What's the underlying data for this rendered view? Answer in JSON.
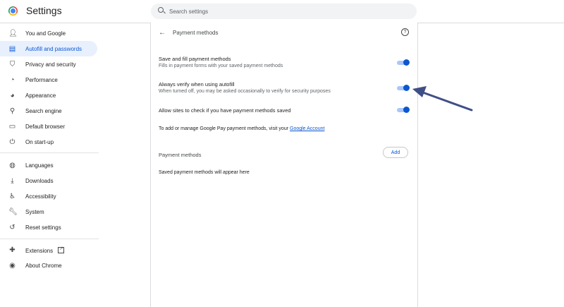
{
  "header": {
    "title": "Settings",
    "search_placeholder": "Search settings"
  },
  "sidebar": {
    "items": [
      {
        "label": "You and Google",
        "icon": "person-icon"
      },
      {
        "label": "Autofill and passwords",
        "icon": "clipboard-icon",
        "active": true
      },
      {
        "label": "Privacy and security",
        "icon": "shield-icon"
      },
      {
        "label": "Performance",
        "icon": "speedometer-icon"
      },
      {
        "label": "Appearance",
        "icon": "palette-icon"
      },
      {
        "label": "Search engine",
        "icon": "search-icon"
      },
      {
        "label": "Default browser",
        "icon": "browser-icon"
      },
      {
        "label": "On start-up",
        "icon": "power-icon"
      },
      {
        "label": "Languages",
        "icon": "globe-icon"
      },
      {
        "label": "Downloads",
        "icon": "download-icon"
      },
      {
        "label": "Accessibility",
        "icon": "accessibility-icon"
      },
      {
        "label": "System",
        "icon": "wrench-icon"
      },
      {
        "label": "Reset settings",
        "icon": "restore-icon"
      },
      {
        "label": "Extensions",
        "icon": "puzzle-icon"
      },
      {
        "label": "About Chrome",
        "icon": "chrome-icon"
      }
    ]
  },
  "main": {
    "title": "Payment methods",
    "settings": [
      {
        "title": "Save and fill payment methods",
        "subtitle": "Fills in payment forms with your saved payment methods",
        "enabled": true
      },
      {
        "title": "Always verify when using autofill",
        "subtitle": "When turned off, you may be asked occasionally to verify for security purposes",
        "enabled": true
      },
      {
        "title": "Allow sites to check if you have payment methods saved",
        "subtitle": "",
        "enabled": true
      }
    ],
    "gpay_text": "To add or manage Google Pay payment methods, visit your",
    "gpay_link": "Google Account",
    "payment_methods_label": "Payment methods",
    "add_label": "Add",
    "empty_text": "Saved payment methods will appear here"
  },
  "colors": {
    "accent": "#0b57d0",
    "toggle_track": "#a8c7fa",
    "active_nav_bg": "#e8f0fe",
    "annotation_arrow": "#3f4f86"
  }
}
